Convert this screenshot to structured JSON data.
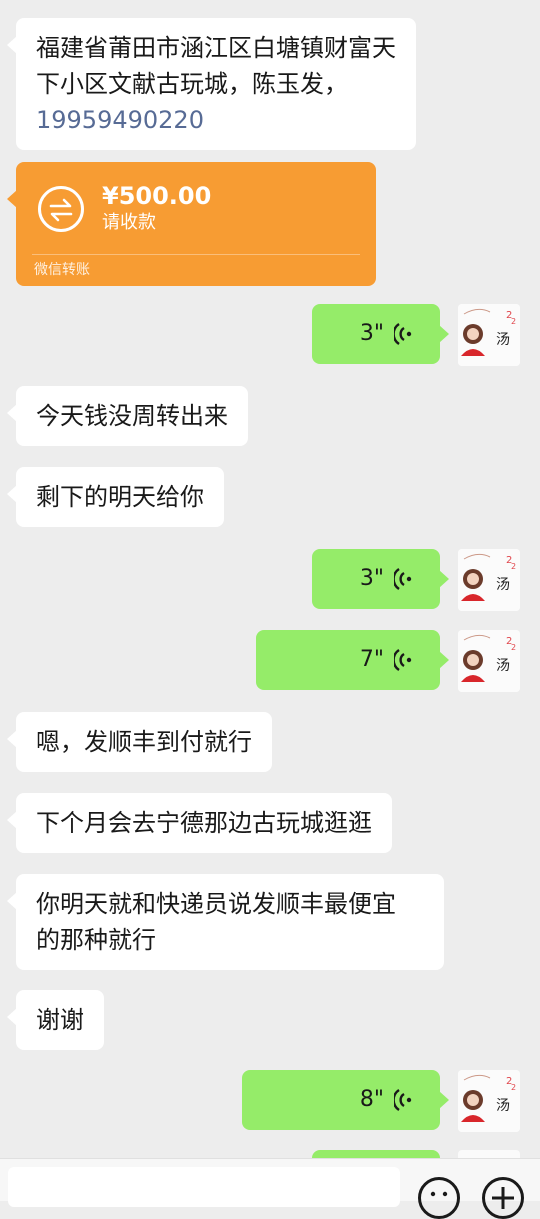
{
  "messages": {
    "address_line1": "福建省莆田市涵江区白塘镇财富天",
    "address_line2": "下小区文献古玩城，陈玉发，",
    "address_phone": "19959490220",
    "transfer": {
      "amount": "¥500.00",
      "status": "请收款",
      "footer": "微信转账"
    },
    "voice_1": "3\"",
    "text_1": "今天钱没周转出来",
    "text_2": "剩下的明天给你",
    "voice_2": "3\"",
    "voice_3": "7\"",
    "text_3": "嗯，发顺丰到付就行",
    "text_4": "下个月会去宁德那边古玩城逛逛",
    "text_5_line1": "你明天就和快递员说发顺丰最便宜",
    "text_5_line2": "的那种就行",
    "text_6": "谢谢",
    "voice_4": "8\""
  },
  "avatar": {
    "caption": "汤",
    "badge": "222"
  },
  "colors": {
    "background": "#ededed",
    "bubble_left": "#ffffff",
    "bubble_right": "#95ec69",
    "transfer": "#f79c33",
    "link": "#576b95"
  },
  "icons": {
    "transfer": "transfer-arrows-icon",
    "voice": "voice-wave-icon",
    "emoji": "emoji-icon",
    "add": "plus-icon"
  }
}
